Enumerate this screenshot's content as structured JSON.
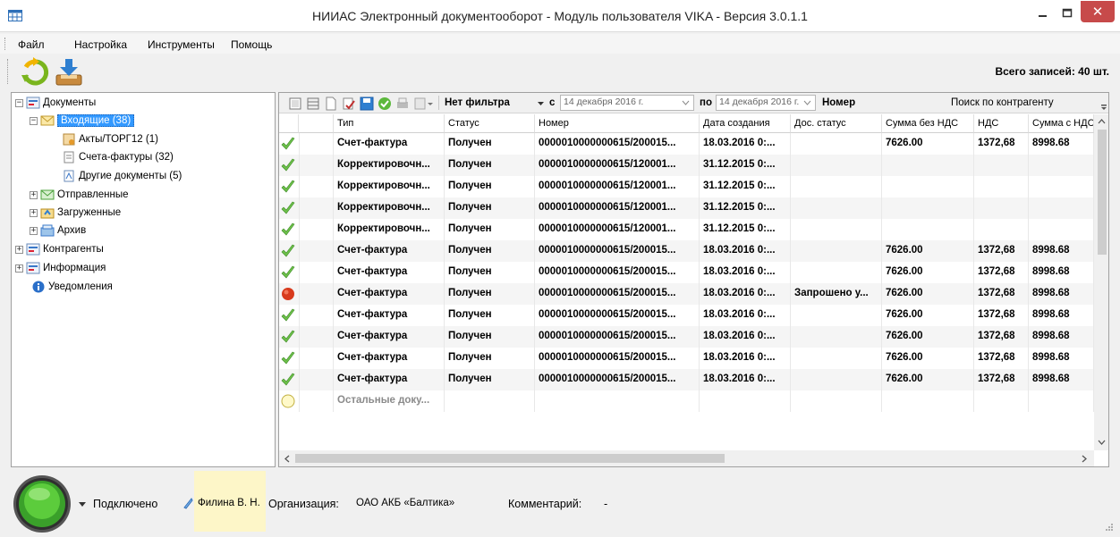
{
  "window": {
    "title": "НИИАС Электронный документооборот - Модуль пользователя VIKA - Версия 3.0.1.1",
    "close_glyph": "✕"
  },
  "menu": [
    "Файл",
    "Настройка",
    "Инструменты",
    "Помощь"
  ],
  "toolbar": {
    "total_label": "Всего записей: 40 шт."
  },
  "tree": {
    "documents": "Документы",
    "incoming": "Входящие (38)",
    "acts": "Акты/ТОРГ12 (1)",
    "invoices": "Счета-фактуры (32)",
    "other_docs": "Другие документы (5)",
    "sent": "Отправленные",
    "loaded": "Загруженные",
    "archive": "Архив",
    "contractors": "Контрагенты",
    "information": "Информация",
    "notifications": "Уведомления"
  },
  "filter": {
    "no_filter": "Нет фильтра",
    "from_label": "с",
    "date_from": "14 декабря  2016 г.",
    "to_label": "по",
    "date_to": "14 декабря  2016 г.",
    "number_label": "Номер",
    "search_label": "Поиск по контрагенту"
  },
  "table": {
    "headers": [
      "Тип",
      "Статус",
      "Номер",
      "Дата создания",
      "Дос. статус",
      "Сумма без НДС",
      "НДС",
      "Сумма с НДС"
    ],
    "rows": [
      {
        "status_icon": "check",
        "type": "Счет-фактура",
        "status": "Получен",
        "number": "0000010000000615/200015...",
        "date": "18.03.2016 0:...",
        "doc_status": "",
        "sum": "7626.00",
        "vat": "1372,68",
        "total": "8998.68"
      },
      {
        "status_icon": "check",
        "type": "Корректировочн...",
        "status": "Получен",
        "number": "0000010000000615/120001...",
        "date": "31.12.2015 0:...",
        "doc_status": "",
        "sum": "",
        "vat": "",
        "total": ""
      },
      {
        "status_icon": "check",
        "type": "Корректировочн...",
        "status": "Получен",
        "number": "0000010000000615/120001...",
        "date": "31.12.2015 0:...",
        "doc_status": "",
        "sum": "",
        "vat": "",
        "total": ""
      },
      {
        "status_icon": "check",
        "type": "Корректировочн...",
        "status": "Получен",
        "number": "0000010000000615/120001...",
        "date": "31.12.2015 0:...",
        "doc_status": "",
        "sum": "",
        "vat": "",
        "total": ""
      },
      {
        "status_icon": "check",
        "type": "Корректировочн...",
        "status": "Получен",
        "number": "0000010000000615/120001...",
        "date": "31.12.2015 0:...",
        "doc_status": "",
        "sum": "",
        "vat": "",
        "total": ""
      },
      {
        "status_icon": "check",
        "type": "Счет-фактура",
        "status": "Получен",
        "number": "0000010000000615/200015...",
        "date": "18.03.2016 0:...",
        "doc_status": "",
        "sum": "7626.00",
        "vat": "1372,68",
        "total": "8998.68"
      },
      {
        "status_icon": "check",
        "type": "Счет-фактура",
        "status": "Получен",
        "number": "0000010000000615/200015...",
        "date": "18.03.2016 0:...",
        "doc_status": "",
        "sum": "7626.00",
        "vat": "1372,68",
        "total": "8998.68"
      },
      {
        "status_icon": "red-dot",
        "type": "Счет-фактура",
        "status": "Получен",
        "number": "0000010000000615/200015...",
        "date": "18.03.2016 0:...",
        "doc_status": "Запрошено у...",
        "sum": "7626.00",
        "vat": "1372,68",
        "total": "8998.68"
      },
      {
        "status_icon": "check",
        "type": "Счет-фактура",
        "status": "Получен",
        "number": "0000010000000615/200015...",
        "date": "18.03.2016 0:...",
        "doc_status": "",
        "sum": "7626.00",
        "vat": "1372,68",
        "total": "8998.68"
      },
      {
        "status_icon": "check",
        "type": "Счет-фактура",
        "status": "Получен",
        "number": "0000010000000615/200015...",
        "date": "18.03.2016 0:...",
        "doc_status": "",
        "sum": "7626.00",
        "vat": "1372,68",
        "total": "8998.68"
      },
      {
        "status_icon": "check",
        "type": "Счет-фактура",
        "status": "Получен",
        "number": "0000010000000615/200015...",
        "date": "18.03.2016 0:...",
        "doc_status": "",
        "sum": "7626.00",
        "vat": "1372,68",
        "total": "8998.68"
      },
      {
        "status_icon": "check",
        "type": "Счет-фактура",
        "status": "Получен",
        "number": "0000010000000615/200015...",
        "date": "18.03.2016 0:...",
        "doc_status": "",
        "sum": "7626.00",
        "vat": "1372,68",
        "total": "8998.68"
      },
      {
        "status_icon": "yellow-dot",
        "type": "Остальные доку...",
        "status": "",
        "number": "",
        "date": "",
        "doc_status": "",
        "sum": "",
        "vat": "",
        "total": ""
      }
    ]
  },
  "status": {
    "connection": "Подключено",
    "user": "Филина В. Н.",
    "org_label": "Организация:",
    "org_name": "ОАО АКБ «Балтика»",
    "comment_label": "Комментарий:",
    "comment_value": "-"
  },
  "colors": {
    "selection": "#3399ff",
    "close_button": "#c74a4a",
    "check_green": "#6cc04a",
    "status_red": "#d83a1c",
    "user_highlight": "#fdf6c8"
  }
}
